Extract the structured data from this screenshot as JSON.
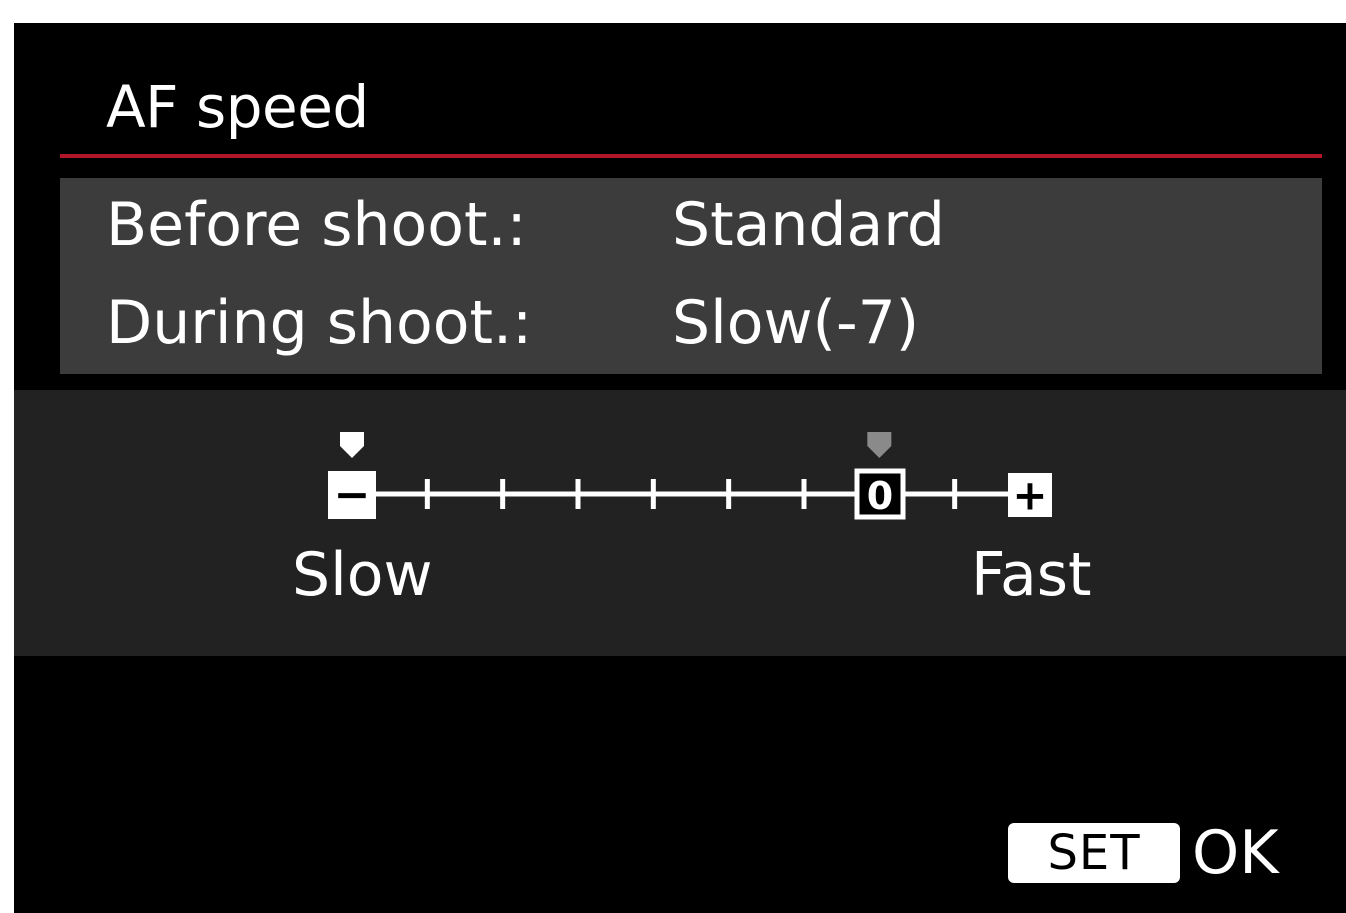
{
  "screen": {
    "title": "AF speed",
    "accent_color": "#b0152a"
  },
  "info": {
    "before": {
      "label": "Before shoot.:",
      "value": "Standard"
    },
    "during": {
      "label": "During shoot.:",
      "value": "Slow(-7)"
    }
  },
  "slider": {
    "min": -7,
    "max": 2,
    "current_value": -7,
    "default_value": 0,
    "minus_symbol": "−",
    "zero_symbol": "0",
    "plus_symbol": "+",
    "slow_label": "Slow",
    "fast_label": "Fast",
    "marker_color": "#ffffff",
    "default_marker_color": "#8a8a8a"
  },
  "footer": {
    "set_key": "SET",
    "ok_label": "OK"
  }
}
